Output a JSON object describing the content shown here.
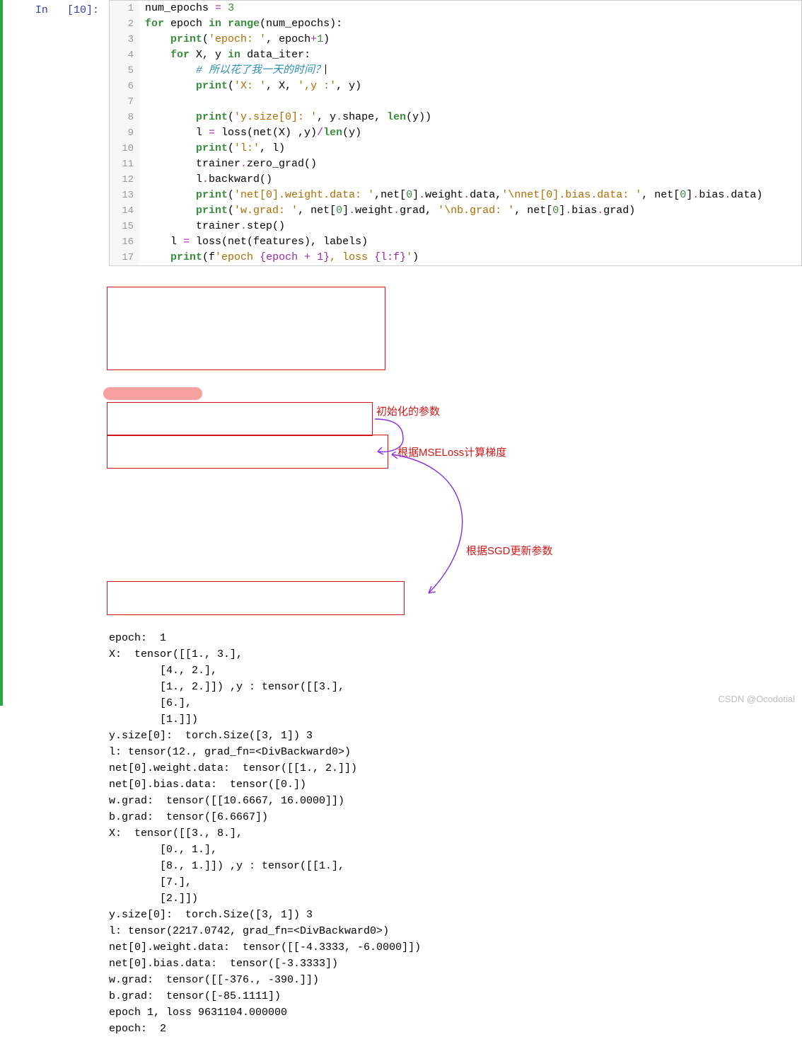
{
  "prompt": {
    "label": "In",
    "number": "10"
  },
  "code": [
    {
      "n": "1",
      "segs": [
        [
          "",
          "num_epochs "
        ],
        [
          "op",
          "="
        ],
        [
          "",
          " "
        ],
        [
          "num",
          "3"
        ]
      ]
    },
    {
      "n": "2",
      "segs": [
        [
          "kw",
          "for"
        ],
        [
          "",
          " epoch "
        ],
        [
          "kw",
          "in"
        ],
        [
          "",
          " "
        ],
        [
          "kw",
          "range"
        ],
        [
          "",
          "(num_epochs):"
        ]
      ]
    },
    {
      "n": "3",
      "segs": [
        [
          "",
          "    "
        ],
        [
          "kw",
          "print"
        ],
        [
          "",
          "("
        ],
        [
          "str",
          "'epoch: '"
        ],
        [
          "",
          ", epoch"
        ],
        [
          "op",
          "+"
        ],
        [
          "num",
          "1"
        ],
        [
          "",
          ")"
        ]
      ]
    },
    {
      "n": "4",
      "segs": [
        [
          "",
          "    "
        ],
        [
          "kw",
          "for"
        ],
        [
          "",
          " X, y "
        ],
        [
          "kw",
          "in"
        ],
        [
          "",
          " data_iter:"
        ]
      ]
    },
    {
      "n": "5",
      "segs": [
        [
          "",
          "        "
        ],
        [
          "cm",
          "# 所以花了我一天的时间？"
        ],
        [
          "cur",
          ""
        ]
      ]
    },
    {
      "n": "6",
      "segs": [
        [
          "",
          "        "
        ],
        [
          "kw",
          "print"
        ],
        [
          "",
          "("
        ],
        [
          "str",
          "'X: '"
        ],
        [
          "",
          ", X, "
        ],
        [
          "str",
          "',y :'"
        ],
        [
          "",
          ", y)"
        ]
      ]
    },
    {
      "n": "7",
      "segs": [
        [
          "",
          ""
        ]
      ]
    },
    {
      "n": "8",
      "segs": [
        [
          "",
          "        "
        ],
        [
          "kw",
          "print"
        ],
        [
          "",
          "("
        ],
        [
          "str",
          "'y.size[0]: '"
        ],
        [
          "",
          ", y"
        ],
        [
          "op",
          "."
        ],
        [
          "",
          "shape, "
        ],
        [
          "kw",
          "len"
        ],
        [
          "",
          "(y))"
        ]
      ]
    },
    {
      "n": "9",
      "segs": [
        [
          "",
          "        l "
        ],
        [
          "op",
          "="
        ],
        [
          "",
          " loss(net(X) ,y)"
        ],
        [
          "op",
          "/"
        ],
        [
          "kw",
          "len"
        ],
        [
          "",
          "(y)"
        ]
      ]
    },
    {
      "n": "10",
      "segs": [
        [
          "",
          "        "
        ],
        [
          "kw",
          "print"
        ],
        [
          "",
          "("
        ],
        [
          "str",
          "'l:'"
        ],
        [
          "",
          ", l)"
        ]
      ]
    },
    {
      "n": "11",
      "segs": [
        [
          "",
          "        trainer"
        ],
        [
          "op",
          "."
        ],
        [
          "",
          "zero_grad()"
        ]
      ]
    },
    {
      "n": "12",
      "segs": [
        [
          "",
          "        l"
        ],
        [
          "op",
          "."
        ],
        [
          "",
          "backward()"
        ]
      ]
    },
    {
      "n": "13",
      "segs": [
        [
          "",
          "        "
        ],
        [
          "kw",
          "print"
        ],
        [
          "",
          "("
        ],
        [
          "str",
          "'net[0].weight.data: '"
        ],
        [
          "",
          ",net["
        ],
        [
          "num",
          "0"
        ],
        [
          "",
          "]"
        ],
        [
          "op",
          "."
        ],
        [
          "",
          "weight"
        ],
        [
          "op",
          "."
        ],
        [
          "",
          "data,"
        ],
        [
          "str",
          "'\\nnet[0].bias.data: '"
        ],
        [
          "",
          ", net["
        ],
        [
          "num",
          "0"
        ],
        [
          "",
          "]"
        ],
        [
          "op",
          "."
        ],
        [
          "",
          "bias"
        ],
        [
          "op",
          "."
        ],
        [
          "",
          "data)"
        ]
      ]
    },
    {
      "n": "14",
      "segs": [
        [
          "",
          "        "
        ],
        [
          "kw",
          "print"
        ],
        [
          "",
          "("
        ],
        [
          "str",
          "'w.grad: '"
        ],
        [
          "",
          ", net["
        ],
        [
          "num",
          "0"
        ],
        [
          "",
          "]"
        ],
        [
          "op",
          "."
        ],
        [
          "",
          "weight"
        ],
        [
          "op",
          "."
        ],
        [
          "",
          "grad, "
        ],
        [
          "str",
          "'\\nb.grad: '"
        ],
        [
          "",
          ", net["
        ],
        [
          "num",
          "0"
        ],
        [
          "",
          "]"
        ],
        [
          "op",
          "."
        ],
        [
          "",
          "bias"
        ],
        [
          "op",
          "."
        ],
        [
          "",
          "grad)"
        ]
      ]
    },
    {
      "n": "15",
      "segs": [
        [
          "",
          "        trainer"
        ],
        [
          "op",
          "."
        ],
        [
          "",
          "step()"
        ]
      ]
    },
    {
      "n": "16",
      "segs": [
        [
          "",
          "    l "
        ],
        [
          "op",
          "="
        ],
        [
          "",
          " loss(net(features), labels)"
        ]
      ]
    },
    {
      "n": "17",
      "segs": [
        [
          "",
          "    "
        ],
        [
          "kw",
          "print"
        ],
        [
          "",
          "(f"
        ],
        [
          "str",
          "'epoch "
        ],
        [
          "fs",
          "{epoch + 1}"
        ],
        [
          "str",
          ", loss "
        ],
        [
          "fs",
          "{l:f}"
        ],
        [
          "str",
          "'"
        ],
        [
          "",
          ")"
        ]
      ]
    }
  ],
  "output": [
    "epoch:  1",
    "X:  tensor([[1., 3.],",
    "        [4., 2.],",
    "        [1., 2.]]) ,y : tensor([[3.],",
    "        [6.],",
    "        [1.]])",
    "y.size[0]:  torch.Size([3, 1]) 3",
    "l: tensor(12., grad_fn=<DivBackward0>)",
    "net[0].weight.data:  tensor([[1., 2.]])",
    "net[0].bias.data:  tensor([0.])",
    "w.grad:  tensor([[10.6667, 16.0000]])",
    "b.grad:  tensor([6.6667])",
    "X:  tensor([[3., 8.],",
    "        [0., 1.],",
    "        [8., 1.]]) ,y : tensor([[1.],",
    "        [7.],",
    "        [2.]])",
    "y.size[0]:  torch.Size([3, 1]) 3",
    "l: tensor(2217.0742, grad_fn=<DivBackward0>)",
    "net[0].weight.data:  tensor([[-4.3333, -6.0000]])",
    "net[0].bias.data:  tensor([-3.3333])",
    "w.grad:  tensor([[-376., -390.]])",
    "b.grad:  tensor([-85.1111])",
    "epoch 1, loss 9631104.000000",
    "epoch:  2"
  ],
  "annotations": {
    "label_init": "初始化的参数",
    "label_grad": "根据MSELoss计算梯度",
    "label_sgd": "根据SGD更新参数"
  },
  "watermark": "CSDN @Ocodotial"
}
